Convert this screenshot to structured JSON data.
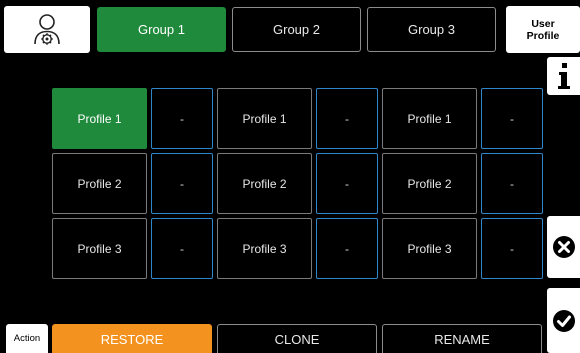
{
  "header": {
    "user_icon": "user-settings-icon",
    "tabs": [
      {
        "label": "Group 1",
        "active": true
      },
      {
        "label": "Group 2",
        "active": false
      },
      {
        "label": "Group 3",
        "active": false
      }
    ],
    "user_profile": {
      "line1": "User",
      "line2": "Profile"
    }
  },
  "side": {
    "info_icon": "info-icon",
    "cancel_icon": "close-icon",
    "confirm_icon": "checkmark-icon"
  },
  "grid": {
    "columns": [
      {
        "rows": [
          {
            "profile": "Profile 1",
            "value": "-",
            "active": true
          },
          {
            "profile": "Profile 2",
            "value": "-",
            "active": false
          },
          {
            "profile": "Profile 3",
            "value": "-",
            "active": false
          }
        ]
      },
      {
        "rows": [
          {
            "profile": "Profile 1",
            "value": "-",
            "active": false
          },
          {
            "profile": "Profile 2",
            "value": "-",
            "active": false
          },
          {
            "profile": "Profile 3",
            "value": "-",
            "active": false
          }
        ]
      },
      {
        "rows": [
          {
            "profile": "Profile 1",
            "value": "-",
            "active": false
          },
          {
            "profile": "Profile 2",
            "value": "-",
            "active": false
          },
          {
            "profile": "Profile 3",
            "value": "-",
            "active": false
          }
        ]
      }
    ]
  },
  "footer": {
    "action_label": "Action",
    "buttons": [
      {
        "label": "RESTORE",
        "active": true
      },
      {
        "label": "CLONE",
        "active": false
      },
      {
        "label": "RENAME",
        "active": false
      }
    ]
  },
  "colors": {
    "active_green": "#1f8a3c",
    "accent_orange": "#f3921e",
    "cell_border_blue": "#2f86c8",
    "background": "#000000"
  }
}
